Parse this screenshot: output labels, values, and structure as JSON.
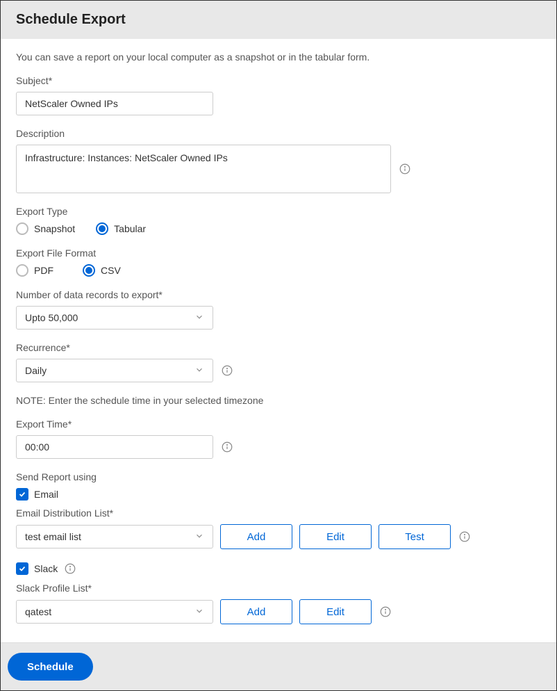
{
  "header": {
    "title": "Schedule Export"
  },
  "intro": "You can save a report on your local computer as a snapshot or in the tabular form.",
  "subject": {
    "label": "Subject*",
    "value": "NetScaler Owned IPs"
  },
  "description": {
    "label": "Description",
    "value": "Infrastructure: Instances: NetScaler Owned IPs"
  },
  "exportType": {
    "label": "Export Type",
    "options": {
      "snapshot": "Snapshot",
      "tabular": "Tabular"
    },
    "selected": "tabular"
  },
  "fileFormat": {
    "label": "Export File Format",
    "options": {
      "pdf": "PDF",
      "csv": "CSV"
    },
    "selected": "csv"
  },
  "records": {
    "label": "Number of data records to export*",
    "value": "Upto 50,000"
  },
  "recurrence": {
    "label": "Recurrence*",
    "value": "Daily"
  },
  "note": "NOTE: Enter the schedule time in your selected timezone",
  "exportTime": {
    "label": "Export Time*",
    "value": "00:00"
  },
  "sendReport": {
    "label": "Send Report using",
    "email": {
      "label": "Email",
      "checked": true
    },
    "slack": {
      "label": "Slack",
      "checked": true
    }
  },
  "emailList": {
    "label": "Email Distribution List*",
    "value": "test email list",
    "buttons": {
      "add": "Add",
      "edit": "Edit",
      "test": "Test"
    }
  },
  "slackList": {
    "label": "Slack Profile List*",
    "value": "qatest",
    "buttons": {
      "add": "Add",
      "edit": "Edit"
    }
  },
  "footer": {
    "schedule": "Schedule"
  }
}
